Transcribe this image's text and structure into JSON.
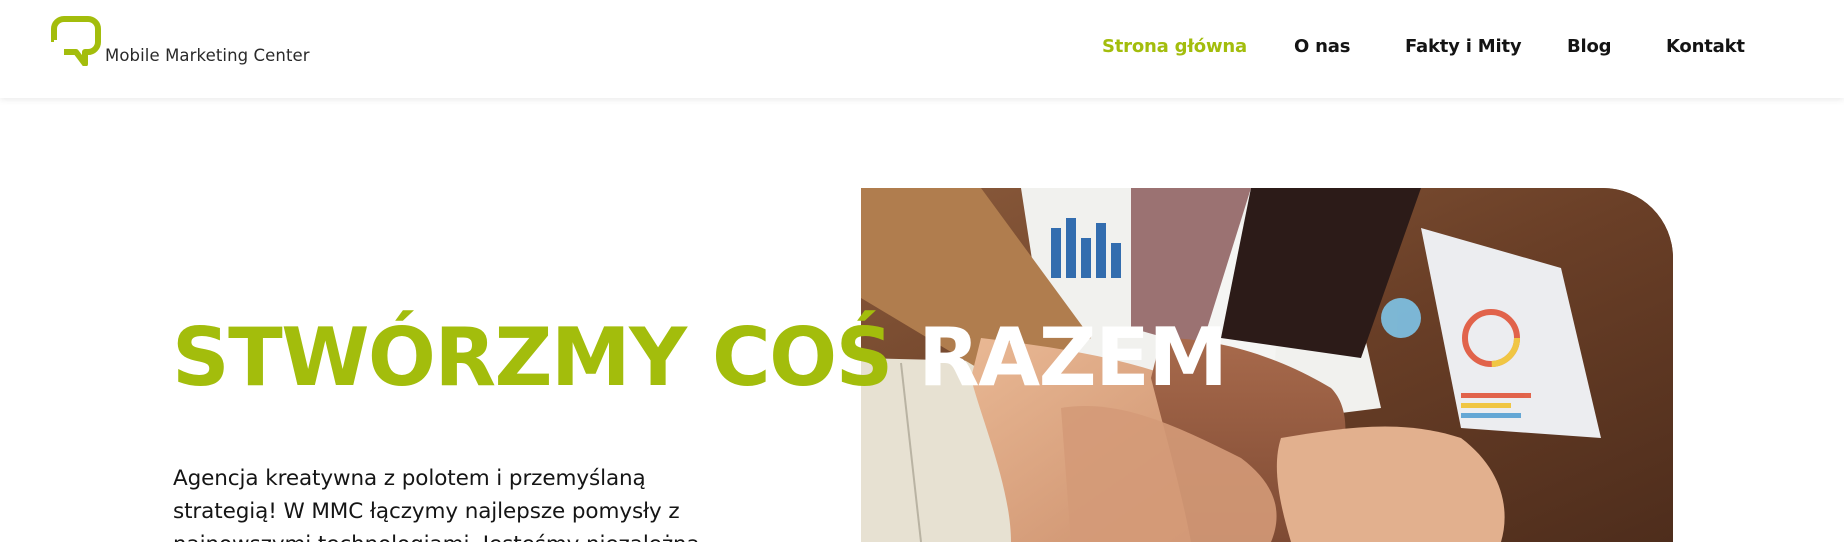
{
  "header": {
    "logo": {
      "icon": "speech-bubble-logo-icon",
      "text": "Mobile Marketing Center",
      "color": "#a3bd0c"
    },
    "nav": [
      {
        "label": "Strona główna",
        "active": true
      },
      {
        "label": "O nas",
        "active": false
      },
      {
        "label": "Fakty i Mity",
        "active": false
      },
      {
        "label": "Blog",
        "active": false
      },
      {
        "label": "Kontakt",
        "active": false
      }
    ]
  },
  "hero": {
    "title_green": "STWÓRZMY COŚ",
    "title_white": "RAZEM",
    "description_lines": [
      "Agencja kreatywna z polotem i przemyślaną",
      "strategią! W MMC łączymy najlepsze pomysły z",
      "najnowszymi technologiami. Jesteśmy niezależną"
    ],
    "image": {
      "subject": "team-hands-stacked-photo",
      "description_icon": "photo-icon"
    }
  },
  "colors": {
    "accent": "#a3bd0c",
    "text": "#141414",
    "background": "#ffffff"
  }
}
